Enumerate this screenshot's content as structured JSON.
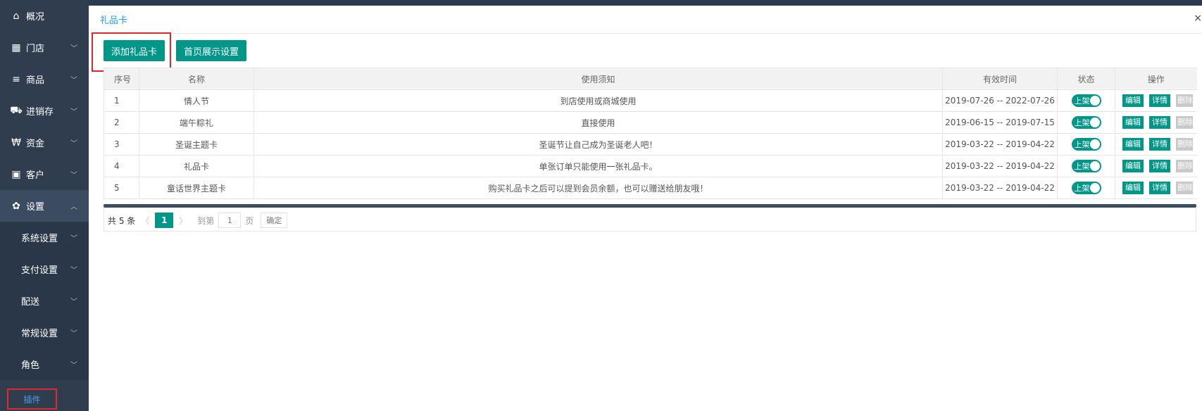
{
  "sidebar": {
    "items": [
      {
        "label": "概况",
        "icon": "home-icon",
        "glyph": "⌂"
      },
      {
        "label": "门店",
        "icon": "building-icon",
        "glyph": "▦"
      },
      {
        "label": "商品",
        "icon": "list-icon",
        "glyph": "≡"
      },
      {
        "label": "进销存",
        "icon": "truck-icon",
        "glyph": "⛟"
      },
      {
        "label": "资金",
        "icon": "won-icon",
        "glyph": "₩"
      },
      {
        "label": "客户",
        "icon": "id-card-icon",
        "glyph": "▣"
      },
      {
        "label": "设置",
        "icon": "gear-icon",
        "glyph": "✿"
      }
    ],
    "sub_items": [
      {
        "label": "系统设置"
      },
      {
        "label": "支付设置"
      },
      {
        "label": "配送"
      },
      {
        "label": "常规设置"
      },
      {
        "label": "角色"
      }
    ],
    "plugin_label": "插件"
  },
  "panel": {
    "title": "礼品卡",
    "close": "×"
  },
  "toolbar": {
    "add_label": "添加礼品卡",
    "home_label": "首页展示设置"
  },
  "table": {
    "headers": [
      "序号",
      "名称",
      "使用须知",
      "有效时间",
      "状态",
      "操作"
    ],
    "rows": [
      {
        "no": "1",
        "name": "情人节",
        "notice": "到店使用或商城使用",
        "period": "2019-07-26 -- 2022-07-26",
        "status": "上架"
      },
      {
        "no": "2",
        "name": "端午粽礼",
        "notice": "直接使用",
        "period": "2019-06-15 -- 2019-07-15",
        "status": "上架"
      },
      {
        "no": "3",
        "name": "圣诞主题卡",
        "notice": "圣诞节让自己成为圣诞老人吧！",
        "period": "2019-03-22 -- 2019-04-22",
        "status": "上架"
      },
      {
        "no": "4",
        "name": "礼品卡",
        "notice": "单张订单只能使用一张礼品卡。",
        "period": "2019-03-22 -- 2019-04-22",
        "status": "上架"
      },
      {
        "no": "5",
        "name": "童话世界主题卡",
        "notice": "购买礼品卡之后可以提到会员余额，也可以赠送给朋友哦！",
        "period": "2019-03-22 -- 2019-04-22",
        "status": "上架"
      }
    ],
    "ops": {
      "edit": "编辑",
      "detail": "详情",
      "delete": "删除"
    }
  },
  "pager": {
    "total": "共 5 条",
    "current": "1",
    "goto": "到第",
    "page_input": "1",
    "page_unit": "页",
    "confirm": "确定"
  },
  "colors": {
    "accent": "#009688",
    "sidebar": "#2f3d4f",
    "highlight": "#e0282d",
    "title": "#1e9fff"
  }
}
